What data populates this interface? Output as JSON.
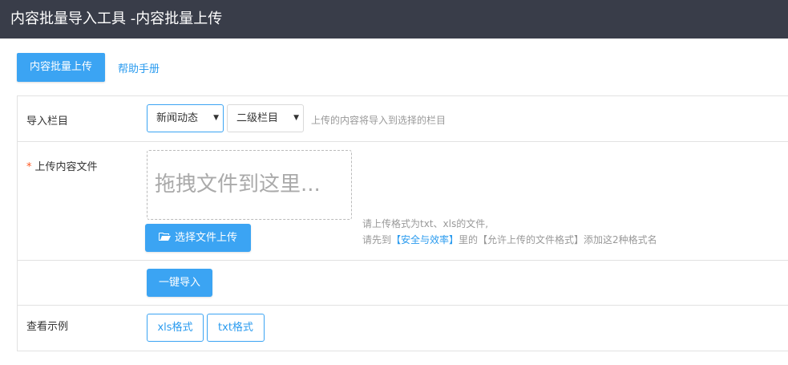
{
  "window": {
    "title": "内容批量导入工具 -内容批量上传"
  },
  "tabs": [
    {
      "label": "内容批量上传",
      "active": true
    },
    {
      "label": "帮助手册",
      "active": false
    }
  ],
  "form": {
    "column_row": {
      "label": "导入栏目",
      "primary_select": "新闻动态",
      "secondary_select": "二级栏目",
      "hint": "上传的内容将导入到选择的栏目"
    },
    "file_row": {
      "required_mark": "*",
      "label": "上传内容文件",
      "dropzone_text": "拖拽文件到这里...",
      "choose_button": "选择文件上传",
      "hint_line1": "请上传格式为txt、xls的文件,",
      "hint_line2_prefix": "请先到",
      "hint_line2_link": "【安全与效率】",
      "hint_line2_suffix": "里的【允许上传的文件格式】添加这2种格式名"
    },
    "import_row": {
      "button": "一键导入"
    },
    "example_row": {
      "label": "查看示例",
      "buttons": [
        "xls格式",
        "txt格式"
      ]
    }
  },
  "colors": {
    "titlebar": "#393d49",
    "accent": "#3ba4f3",
    "link": "#2a9bef",
    "required": "#ff5722"
  },
  "icons": {
    "choose_button_icon": "folder-open-icon",
    "select_caret": "caret-down-icon"
  }
}
